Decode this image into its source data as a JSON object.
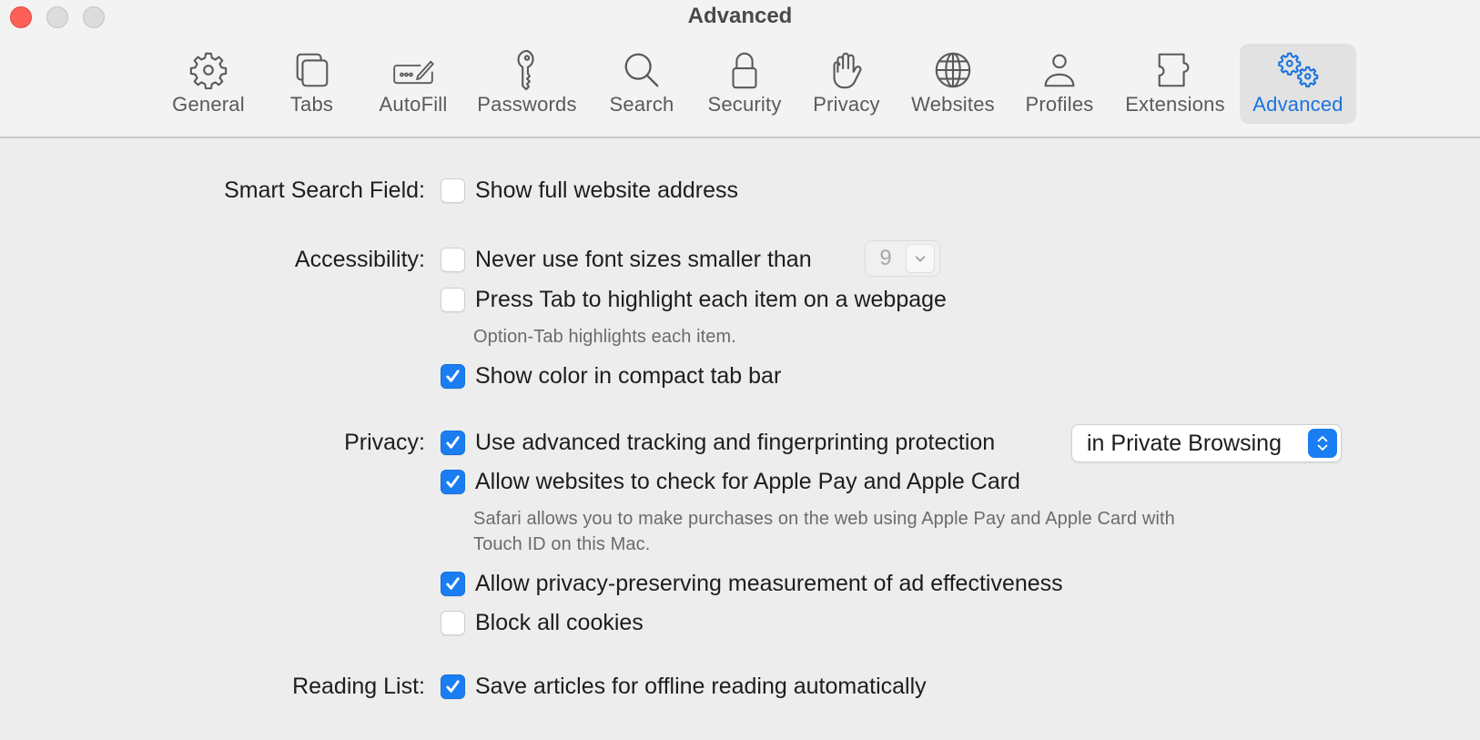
{
  "window": {
    "title": "Advanced",
    "traffic_lights": [
      "close",
      "minimize",
      "zoom"
    ]
  },
  "toolbar": {
    "items": [
      {
        "label": "General",
        "icon": "gear-icon",
        "active": false
      },
      {
        "label": "Tabs",
        "icon": "tabs-icon",
        "active": false
      },
      {
        "label": "AutoFill",
        "icon": "autofill-icon",
        "active": false
      },
      {
        "label": "Passwords",
        "icon": "key-icon",
        "active": false
      },
      {
        "label": "Search",
        "icon": "magnifier-icon",
        "active": false
      },
      {
        "label": "Security",
        "icon": "lock-icon",
        "active": false
      },
      {
        "label": "Privacy",
        "icon": "hand-icon",
        "active": false
      },
      {
        "label": "Websites",
        "icon": "globe-icon",
        "active": false
      },
      {
        "label": "Profiles",
        "icon": "person-icon",
        "active": false
      },
      {
        "label": "Extensions",
        "icon": "puzzle-icon",
        "active": false
      },
      {
        "label": "Advanced",
        "icon": "gears-icon",
        "active": true
      }
    ]
  },
  "colors": {
    "accent": "#1a7ef2",
    "active_label": "#1a73e0",
    "window_bg": "#ededed",
    "close_button": "#fe5f57"
  },
  "sections": {
    "smart_search": {
      "label": "Smart Search Field:",
      "options": [
        {
          "label": "Show full website address",
          "checked": false
        }
      ]
    },
    "accessibility": {
      "label": "Accessibility:",
      "options": [
        {
          "label": "Never use font sizes smaller than",
          "checked": false
        },
        {
          "label": "Press Tab to highlight each item on a webpage",
          "checked": false
        },
        {
          "label": "Show color in compact tab bar",
          "checked": true
        }
      ],
      "font_size_value": "9",
      "tab_hint": "Option-Tab highlights each item."
    },
    "privacy": {
      "label": "Privacy:",
      "options": [
        {
          "label": "Use advanced tracking and fingerprinting protection",
          "checked": true
        },
        {
          "label": "Allow websites to check for Apple Pay and Apple Card",
          "checked": true
        },
        {
          "label": "Allow privacy-preserving measurement of ad effectiveness",
          "checked": true
        },
        {
          "label": "Block all cookies",
          "checked": false
        }
      ],
      "tracking_scope": "in Private Browsing",
      "apple_pay_hint_line1": "Safari allows you to make purchases on the web using Apple Pay and Apple Card with",
      "apple_pay_hint_line2": "Touch ID on this Mac."
    },
    "reading_list": {
      "label": "Reading List:",
      "options": [
        {
          "label": "Save articles for offline reading automatically",
          "checked": true
        }
      ]
    }
  }
}
